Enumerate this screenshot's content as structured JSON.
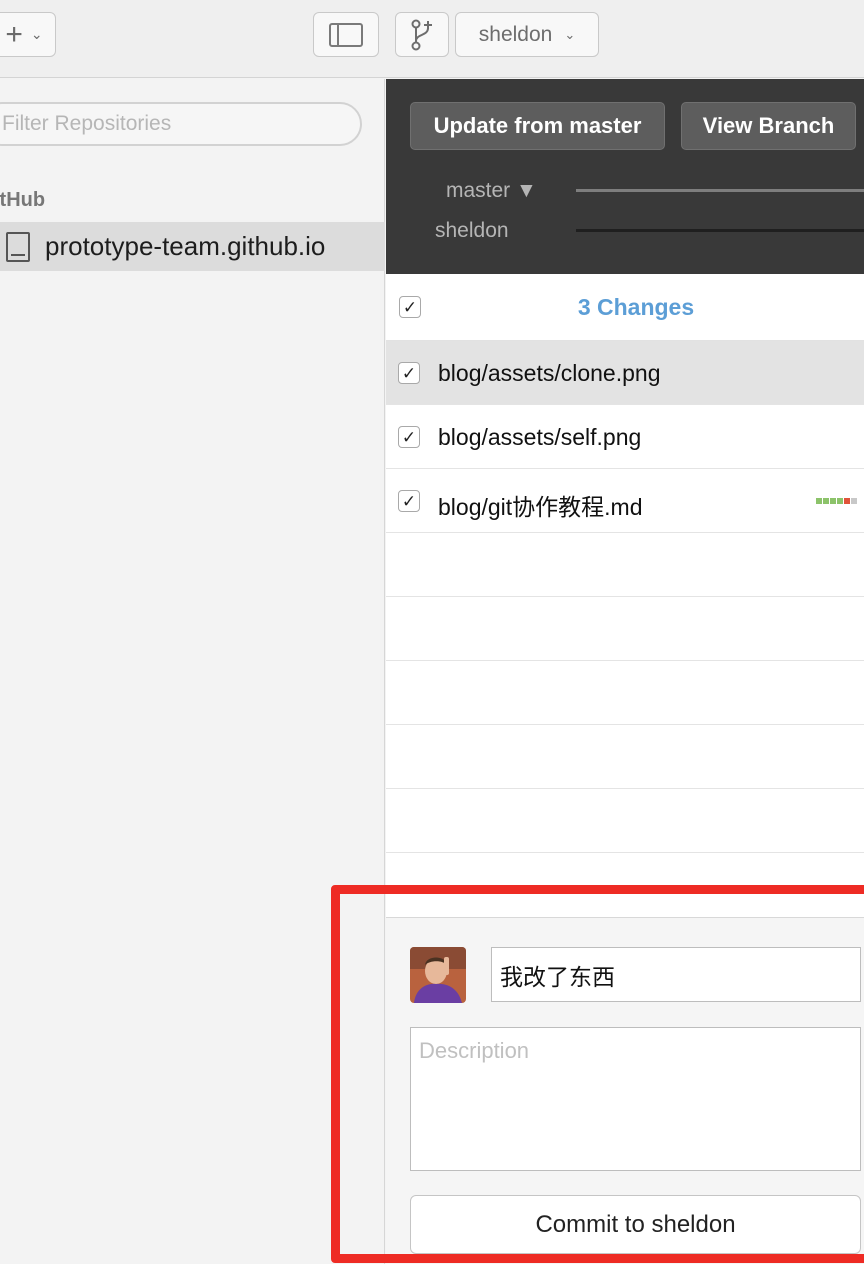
{
  "toolbar": {
    "add_icon": "plus-icon",
    "sidebar_toggle_icon": "sidebar-icon",
    "branch_icon": "branch-icon",
    "branch_selector": {
      "value": "sheldon"
    }
  },
  "sidebar": {
    "filter_placeholder": "Filter Repositories",
    "section_label": "itHub",
    "repos": [
      {
        "label": "prototype-team.github.io",
        "selected": true
      }
    ]
  },
  "main": {
    "buttons": {
      "update": "Update from master",
      "view_branch": "View Branch"
    },
    "branches": {
      "master_label": "master ▼",
      "sheldon_label": "sheldon"
    },
    "changes_title": "3 Changes",
    "files": [
      {
        "name": "blog/assets/clone.png",
        "checked": true,
        "selected": true
      },
      {
        "name": "blog/assets/self.png",
        "checked": true,
        "selected": false
      },
      {
        "name": "blog/git协作教程.md",
        "checked": true,
        "selected": false,
        "diffstat": [
          "#8cc36a",
          "#8cc36a",
          "#8cc36a",
          "#8cc36a",
          "#e0533a",
          "#c8c8c8"
        ]
      }
    ],
    "check_glyph": "✓"
  },
  "commit": {
    "summary_value": "我改了东西",
    "description_placeholder": "Description",
    "button_label": "Commit to sheldon"
  },
  "colors": {
    "accent": "#5c9ed6",
    "highlight": "#ee2b24",
    "dark_header": "#393939"
  }
}
